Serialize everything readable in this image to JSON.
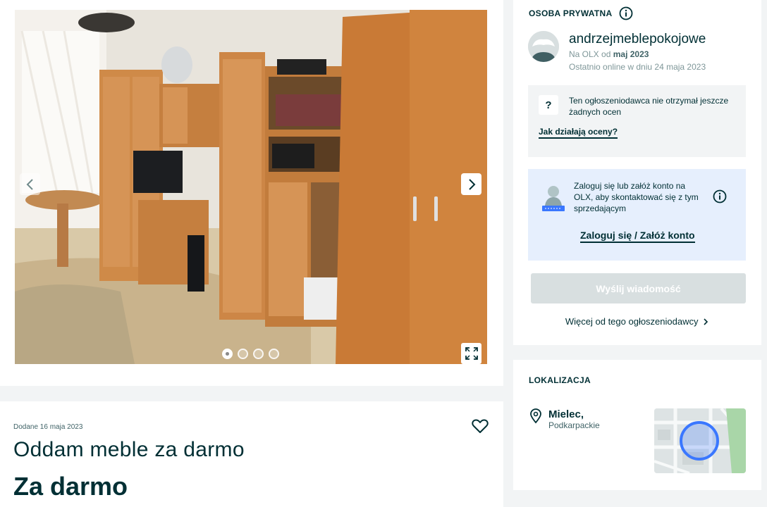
{
  "gallery": {
    "photo_alt": "Meble pokojowe",
    "slide_count": 4,
    "active_slide": 1
  },
  "listing": {
    "added": "Dodane 16 maja 2023",
    "title": "Oddam meble za darmo",
    "price": "Za darmo"
  },
  "seller": {
    "type_label": "OSOBA PRYWATNA",
    "name": "andrzejmeblepokojowe",
    "since_prefix": "Na OLX od",
    "since_value": "maj 2023",
    "last_online": "Ostatnio online w dniu 24 maja 2023",
    "ratings_text": "Ten ogłoszeniodawca nie otrzymał jeszcze żadnych ocen",
    "ratings_link": "Jak działają oceny?",
    "login_text": "Zaloguj się lub załóż konto na OLX, aby skontaktować się z tym sprzedającym",
    "login_link": "Zaloguj się / Załóż konto",
    "send_button": "Wyślij wiadomość",
    "more_link": "Więcej od tego ogłoszeniodawcy"
  },
  "location": {
    "heading": "LOKALIZACJA",
    "city": "Mielec,",
    "region": "Podkarpackie"
  },
  "colors": {
    "primary": "#002f34",
    "disabled_button": "#d8dfe0",
    "login_bg": "#e6effd",
    "map_accent": "#3a77ff"
  }
}
